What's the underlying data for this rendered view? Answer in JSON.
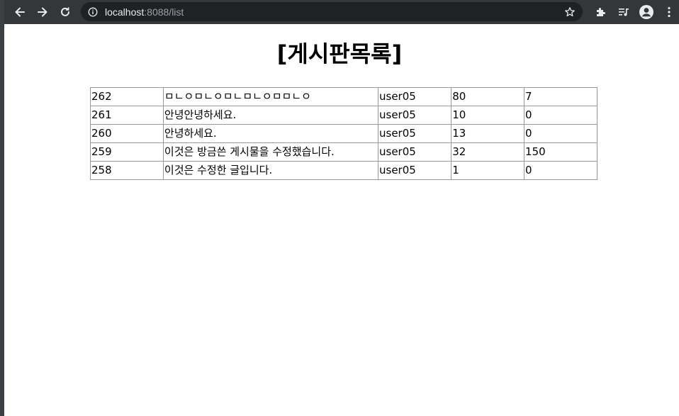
{
  "browser": {
    "url_host": "localhost",
    "url_path": ":8088/list"
  },
  "page": {
    "title": "[게시판목록]"
  },
  "board": {
    "rows": [
      {
        "no": "262",
        "title": "ㅁㄴㅇㅁㄴㅇㅁㄴㅁㄴㅇㅁㅁㄴㅇ",
        "writer": "user05",
        "hit": "80",
        "like": "7"
      },
      {
        "no": "261",
        "title": "안녕안녕하세요.",
        "writer": "user05",
        "hit": "10",
        "like": "0"
      },
      {
        "no": "260",
        "title": "안녕하세요.",
        "writer": "user05",
        "hit": "13",
        "like": "0"
      },
      {
        "no": "259",
        "title": "이것은 방금쓴 게시물을 수정했습니다.",
        "writer": "user05",
        "hit": "32",
        "like": "150"
      },
      {
        "no": "258",
        "title": "이것은 수정한 글입니다.",
        "writer": "user05",
        "hit": "1",
        "like": "0"
      }
    ]
  }
}
